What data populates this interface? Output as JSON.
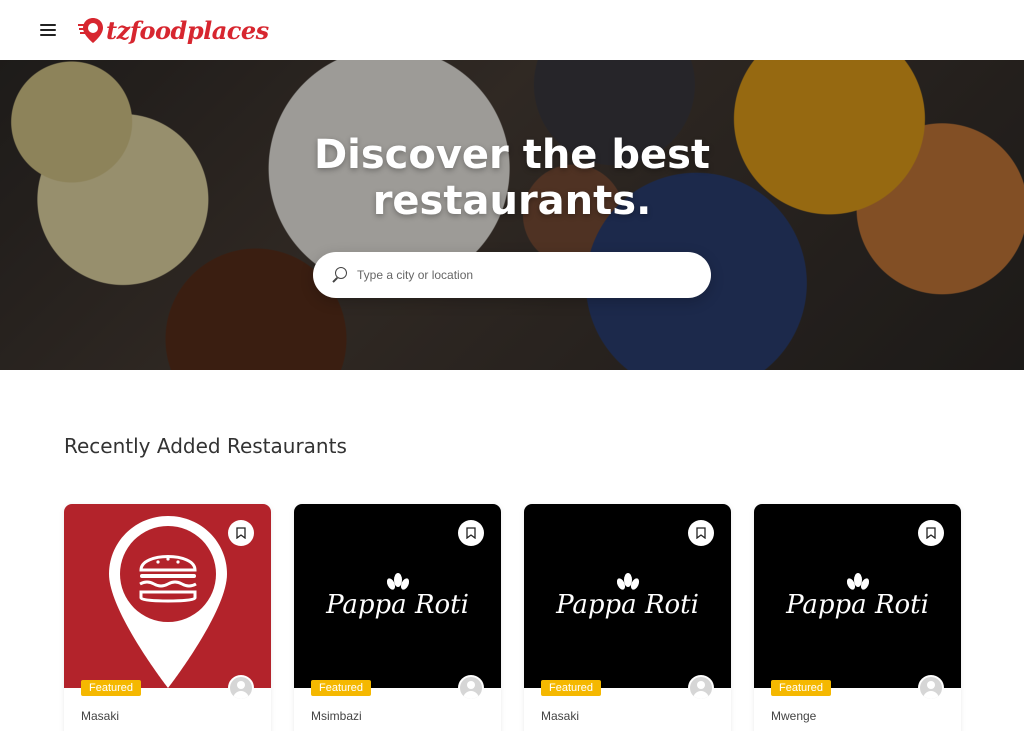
{
  "header": {
    "logo_text": "tzfoodplaces",
    "menu_icon": "hamburger-menu-icon"
  },
  "hero": {
    "title": "Discover the best restaurants.",
    "search": {
      "placeholder": "Type a city or location",
      "value": ""
    }
  },
  "section": {
    "title": "Recently Added Restaurants"
  },
  "cards": [
    {
      "location": "Masaki",
      "badge": "Featured",
      "logo": "burger-pin-logo"
    },
    {
      "location": "Msimbazi",
      "badge": "Featured",
      "logo_text": "Pappa Roti"
    },
    {
      "location": "Masaki",
      "badge": "Featured",
      "logo_text": "Pappa Roti"
    },
    {
      "location": "Mwenge",
      "badge": "Featured",
      "logo_text": "Pappa Roti"
    }
  ],
  "colors": {
    "brand": "#d7262f",
    "badge": "#f5b800",
    "card_red": "#b3232b"
  }
}
